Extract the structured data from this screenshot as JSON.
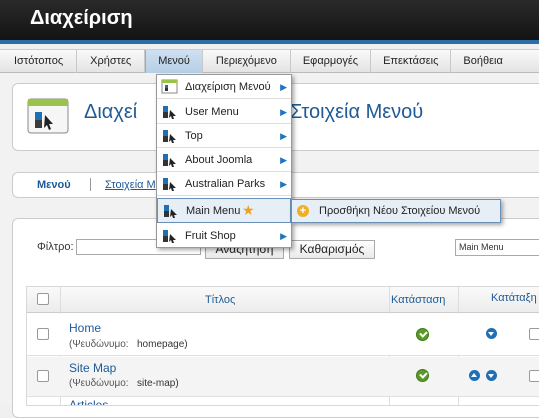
{
  "header": {
    "title": "Διαχείριση"
  },
  "menubar": {
    "items": [
      "Ιστότοπος",
      "Χρήστες",
      "Μενού",
      "Περιεχόμενο",
      "Εφαρμογές",
      "Επεκτάσεις",
      "Βοήθεια"
    ]
  },
  "page": {
    "title_left": "Διαχεί",
    "title_right": "Στοιχεία Μενού"
  },
  "submenu": {
    "menus": "Μενού",
    "items": "Στοιχεία Μ"
  },
  "filter": {
    "label": "Φίλτρο:",
    "search_btn": "Αναζήτηση",
    "clear_btn": "Καθαρισμός",
    "menu_select": "Main Menu"
  },
  "table": {
    "headers": {
      "title": "Τίτλος",
      "status": "Κατάσταση",
      "ordering": "Κατάταξη"
    },
    "rows": [
      {
        "title": "Home",
        "alias_label": "(Ψευδώνυμο:",
        "alias": "homepage)"
      },
      {
        "title": "Site Map",
        "alias_label": "(Ψευδώνυμο:",
        "alias": "site-map)"
      }
    ],
    "partial_row": "Articles"
  },
  "dropdown": {
    "items": [
      {
        "label": "Διαχείριση Μενού",
        "arrow": "▶"
      },
      {
        "label": "User Menu",
        "arrow": "▶"
      },
      {
        "label": "Top",
        "arrow": "▶"
      },
      {
        "label": "About Joomla",
        "arrow": "▶"
      },
      {
        "label": "Australian Parks",
        "arrow": "▶"
      },
      {
        "label": "Main Menu",
        "arrow": "★"
      },
      {
        "label": "Fruit Shop",
        "arrow": "▶"
      }
    ],
    "flyout": "Προσθήκη Νέου Στοιχείου Μενού"
  },
  "colors": {
    "accent": "#1e5a96",
    "header": "#1a1a1a",
    "published": "#5a9a25"
  }
}
